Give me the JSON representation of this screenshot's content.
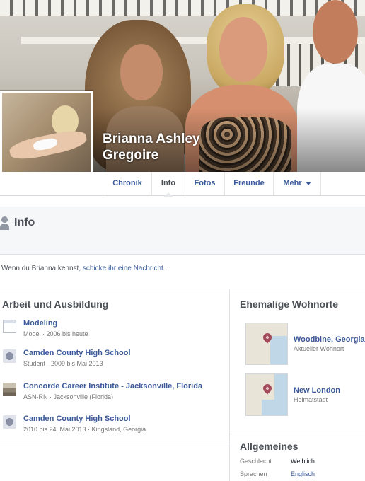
{
  "profile": {
    "name": "Brianna Ashley Gregoire"
  },
  "tabs": [
    {
      "label": "Chronik",
      "active": false
    },
    {
      "label": "Info",
      "active": true
    },
    {
      "label": "Fotos",
      "active": false
    },
    {
      "label": "Freunde",
      "active": false
    },
    {
      "label": "Mehr",
      "active": false
    }
  ],
  "info": {
    "title": "Info",
    "message_prefix": "Wenn du Brianna kennst, ",
    "message_link": "schicke ihr eine Nachricht",
    "message_suffix": "."
  },
  "work": {
    "title": "Arbeit und Ausbildung",
    "items": [
      {
        "title": "Modeling",
        "sub": "Model · 2006 bis heute",
        "icon": "page-icon"
      },
      {
        "title": "Camden County High School",
        "sub": "Student · 2009 bis Mai 2013",
        "icon": "school-icon"
      },
      {
        "title": "Concorde Career Institute - Jacksonville, Florida",
        "sub": "ASN-RN · Jacksonville (Florida)",
        "icon": "building-icon"
      },
      {
        "title": "Camden County High School",
        "sub": "2010 bis 24. Mai 2013 · Kingsland, Georgia",
        "icon": "school-icon"
      }
    ]
  },
  "places": {
    "title": "Ehemalige Wohnorte",
    "items": [
      {
        "name": "Woodbine, Georgia",
        "sub": "Aktueller Wohnort"
      },
      {
        "name": "New London",
        "sub": "Heimatstadt"
      }
    ]
  },
  "general": {
    "title": "Allgemeines",
    "rows": [
      {
        "key": "Geschlecht",
        "value": "Weiblich"
      },
      {
        "key": "Sprachen",
        "value": "Englisch"
      }
    ]
  },
  "colors": {
    "link": "#3b5998",
    "muted": "#777777",
    "heading": "#4b4f56"
  }
}
